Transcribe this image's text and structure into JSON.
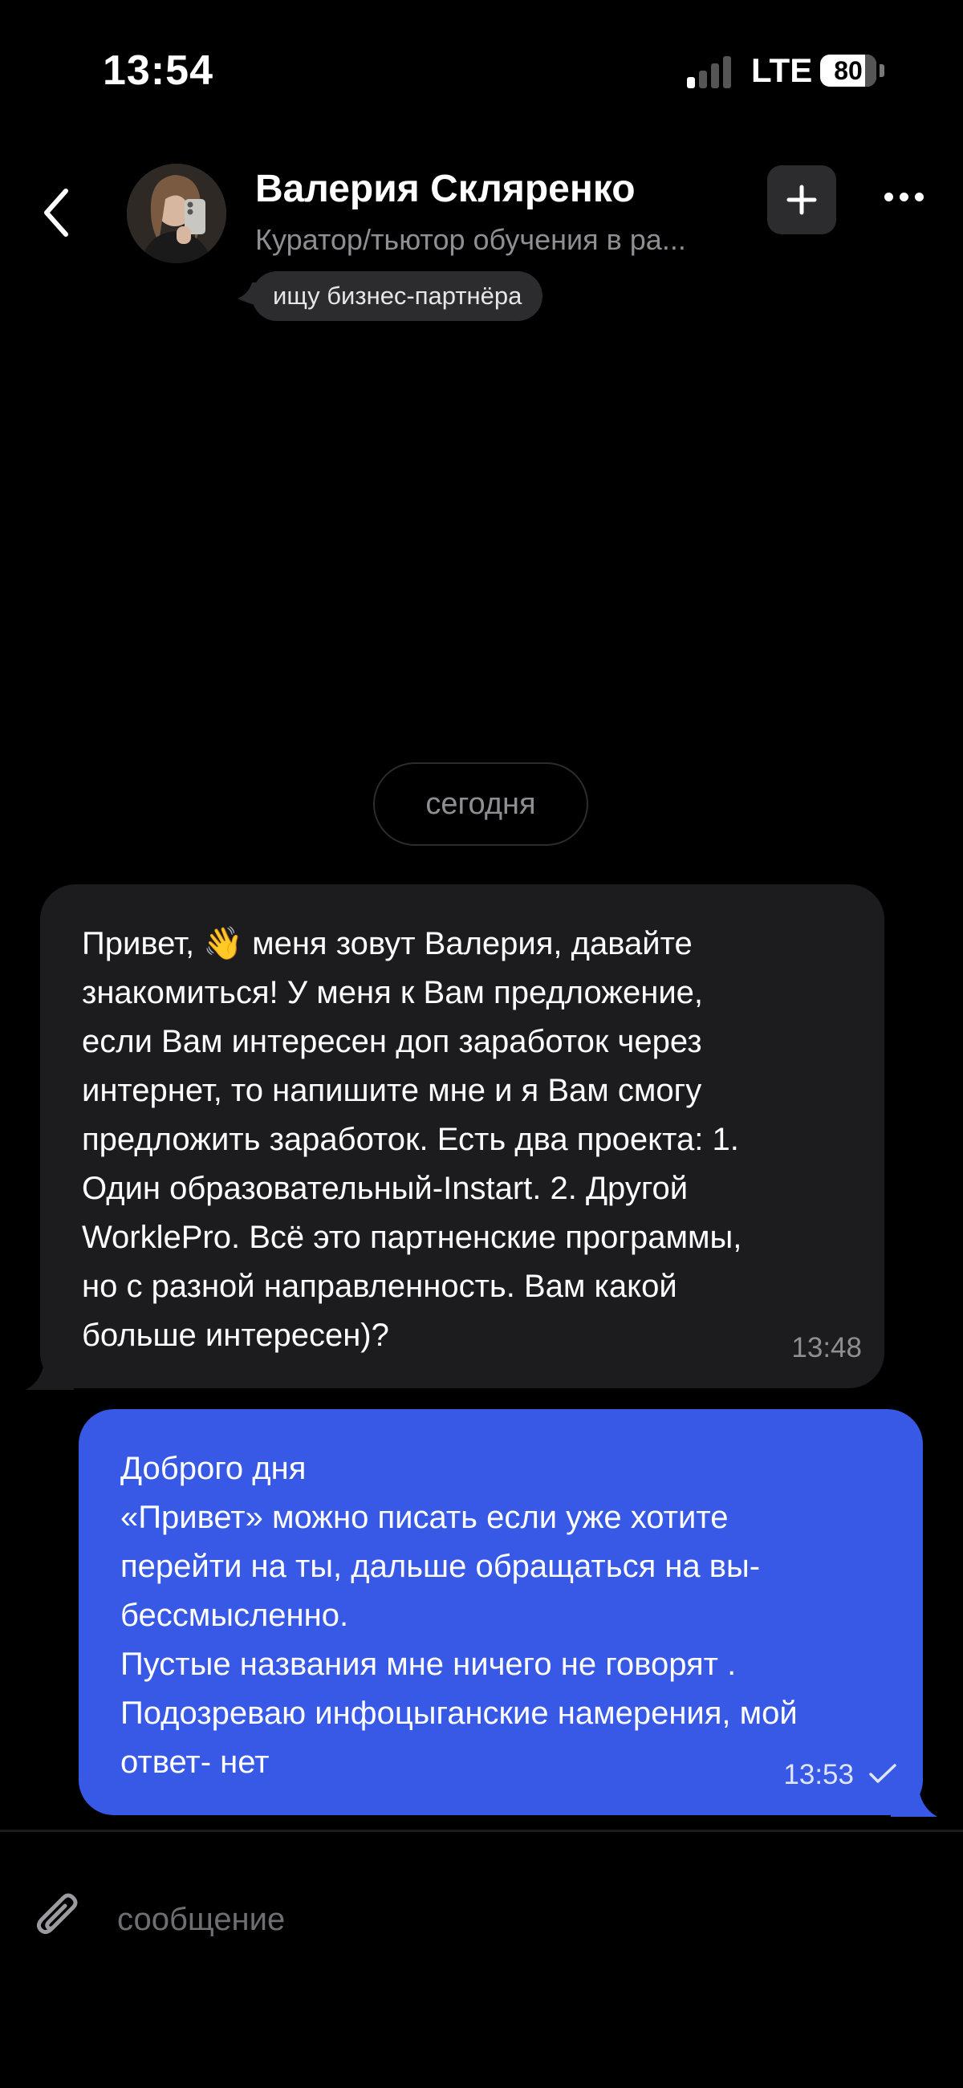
{
  "status_bar": {
    "time": "13:54",
    "network": "LTE",
    "battery": "80",
    "battery_level_percent": 80
  },
  "header": {
    "back_icon": "chevron-left-icon",
    "contact_name": "Валерия Скляренко",
    "contact_subtitle": "Куратор/тьютор обучения в ра...",
    "status_tag": "ищу бизнес-партнёра",
    "add_icon": "plus-icon",
    "more_icon": "ellipsis-icon"
  },
  "chat": {
    "date_separator": "сегодня",
    "messages": [
      {
        "direction": "incoming",
        "text": "Привет, 👋 меня зовут Валерия, давайте\nзнакомиться!  У меня к Вам предложение,\nесли Вам интересен доп заработок через\nинтернет, то напишите мне и я Вам смогу\nпредложить заработок. Есть два проекта: 1.\nОдин образовательный-Instart. 2. Другой\nWorklePro. Всё это партненские программы,\nно с разной направленность. Вам какой\nбольше интересен)?",
        "time": "13:48"
      },
      {
        "direction": "outgoing",
        "text": "Доброго дня\n«Привет» можно писать если уже хотите\nперейти на ты, дальше обращаться на вы-\nбессмысленно.\nПустые названия мне ничего не говорят .\nПодозреваю инфоцыганские намерения, мой\nответ- нет",
        "time": "13:53",
        "status_icon": "check-icon"
      }
    ]
  },
  "composer": {
    "attach_icon": "paperclip-icon",
    "placeholder": "сообщение"
  },
  "colors": {
    "background": "#000000",
    "incoming_bubble": "#1c1c1e",
    "outgoing_bubble": "#3759e6",
    "secondary_text": "#8e8e93"
  }
}
